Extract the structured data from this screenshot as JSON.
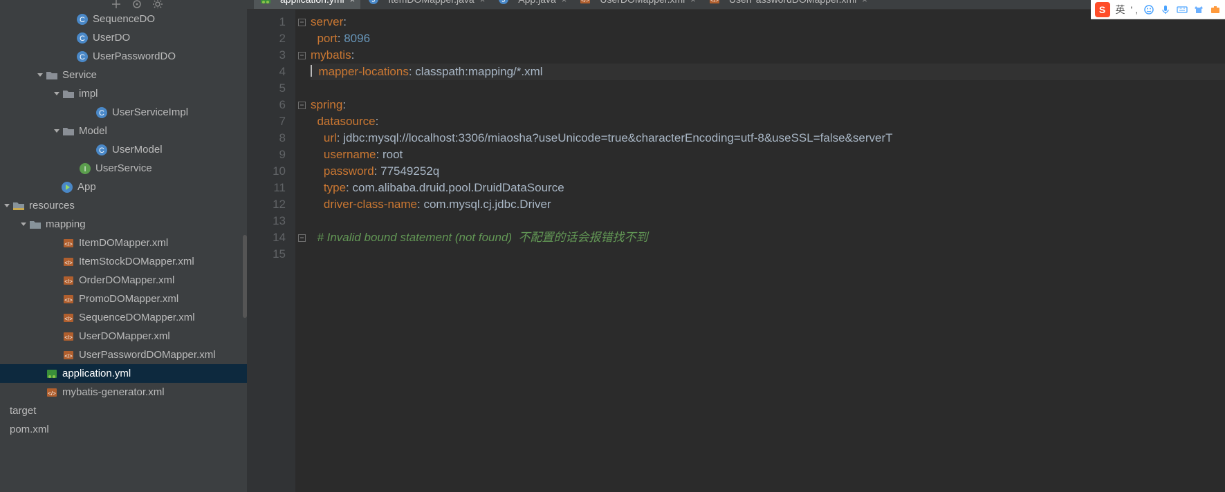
{
  "tree": {
    "items": [
      {
        "indent": 96,
        "arrow": 0,
        "icon": "class",
        "label": "SequenceDO"
      },
      {
        "indent": 96,
        "arrow": 0,
        "icon": "class",
        "label": "UserDO"
      },
      {
        "indent": 96,
        "arrow": 0,
        "icon": "class",
        "label": "UserPasswordDO"
      },
      {
        "indent": 52,
        "arrow": 1,
        "icon": "pkg",
        "label": "Service"
      },
      {
        "indent": 76,
        "arrow": 1,
        "icon": "pkg",
        "label": "impl"
      },
      {
        "indent": 124,
        "arrow": 0,
        "icon": "class",
        "label": "UserServiceImpl"
      },
      {
        "indent": 76,
        "arrow": 1,
        "icon": "pkg",
        "label": "Model"
      },
      {
        "indent": 124,
        "arrow": 0,
        "icon": "class",
        "label": "UserModel"
      },
      {
        "indent": 100,
        "arrow": 0,
        "icon": "iface",
        "label": "UserService"
      },
      {
        "indent": 74,
        "arrow": 0,
        "icon": "run",
        "label": "App"
      },
      {
        "indent": 4,
        "arrow": 1,
        "icon": "resdir",
        "label": "resources"
      },
      {
        "indent": 28,
        "arrow": 1,
        "icon": "dir",
        "label": "mapping"
      },
      {
        "indent": 76,
        "arrow": 0,
        "icon": "xml",
        "label": "ItemDOMapper.xml"
      },
      {
        "indent": 76,
        "arrow": 0,
        "icon": "xml",
        "label": "ItemStockDOMapper.xml"
      },
      {
        "indent": 76,
        "arrow": 0,
        "icon": "xml",
        "label": "OrderDOMapper.xml"
      },
      {
        "indent": 76,
        "arrow": 0,
        "icon": "xml",
        "label": "PromoDOMapper.xml"
      },
      {
        "indent": 76,
        "arrow": 0,
        "icon": "xml",
        "label": "SequenceDOMapper.xml"
      },
      {
        "indent": 76,
        "arrow": 0,
        "icon": "xml",
        "label": "UserDOMapper.xml"
      },
      {
        "indent": 76,
        "arrow": 0,
        "icon": "xml",
        "label": "UserPasswordDOMapper.xml"
      },
      {
        "indent": 52,
        "arrow": 0,
        "icon": "yml",
        "label": "application.yml",
        "sel": true
      },
      {
        "indent": 52,
        "arrow": 0,
        "icon": "xml",
        "label": "mybatis-generator.xml"
      },
      {
        "indent": 0,
        "arrow": 0,
        "icon": "none",
        "label": "target"
      },
      {
        "indent": 0,
        "arrow": 0,
        "icon": "none",
        "label": "pom.xml"
      }
    ]
  },
  "tabs": [
    {
      "icon": "yml",
      "label": "application.yml",
      "active": true
    },
    {
      "icon": "java",
      "label": "ItemDOMapper.java"
    },
    {
      "icon": "java",
      "label": "App.java"
    },
    {
      "icon": "xml",
      "label": "UserDOMapper.xml"
    },
    {
      "icon": "xml",
      "label": "UserPasswordDOMapper.xml"
    }
  ],
  "code": {
    "lines": 15,
    "content": {
      "l1": {
        "key": "server",
        "colon": ":"
      },
      "l2": {
        "key": "  port",
        "colon": ": ",
        "val": "8096"
      },
      "l3": {
        "key": "mybatis",
        "colon": ":"
      },
      "l4": {
        "key": "  mapper-locations",
        "colon": ": ",
        "val": "classpath:mapping/*.xml"
      },
      "l5": "",
      "l6": {
        "key": "spring",
        "colon": ":"
      },
      "l7": {
        "key": "  datasource",
        "colon": ":"
      },
      "l8": {
        "key": "    url",
        "colon": ": ",
        "val": "jdbc:mysql://localhost:3306/miaosha?useUnicode=true&characterEncoding=utf-8&useSSL=false&serverT"
      },
      "l9": {
        "key": "    username",
        "colon": ": ",
        "val": "root"
      },
      "l10": {
        "key": "    password",
        "colon": ": ",
        "val": "77549252q"
      },
      "l11": {
        "key": "    type",
        "colon": ": ",
        "val": "com.alibaba.druid.pool.DruidDataSource"
      },
      "l12": {
        "key": "    driver-class-name",
        "colon": ": ",
        "val": "com.mysql.cj.jdbc.Driver"
      },
      "l13": "",
      "l14_comment": "  # Invalid bound statement (not found)  不配置的话会报错找不到"
    }
  },
  "ime": {
    "logo": "S",
    "lang": "英",
    "punct": "' ,"
  }
}
